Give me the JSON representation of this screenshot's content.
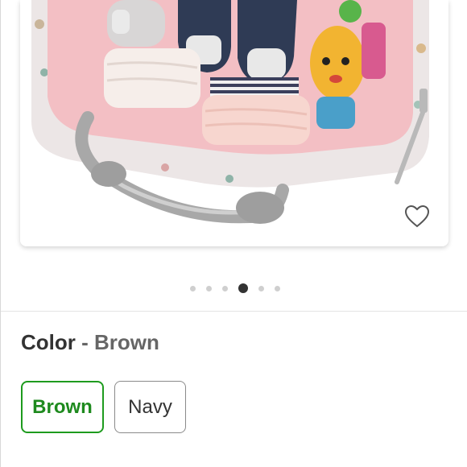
{
  "product": {
    "image_alt": "diaper bag interior with baby items",
    "favorite_icon": "heart-outline-icon"
  },
  "carousel": {
    "total": 6,
    "active_index": 3
  },
  "color_selector": {
    "label": "Color",
    "separator": "-",
    "selected_value": "Brown",
    "options": [
      {
        "label": "Brown",
        "selected": true
      },
      {
        "label": "Navy",
        "selected": false
      }
    ]
  },
  "colors": {
    "selected_accent": "#1e9b1e"
  }
}
